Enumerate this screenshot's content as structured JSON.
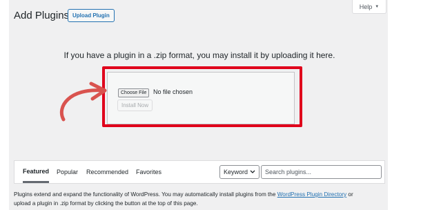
{
  "header": {
    "title": "Add Plugins",
    "upload_button": "Upload Plugin",
    "help_tab": "Help",
    "help_caret": "▼"
  },
  "upload": {
    "instructions": "If you have a plugin in a .zip format, you may install it by uploading it here.",
    "choose_file_button": "Choose File",
    "file_status": "No file chosen",
    "install_button": "Install Now"
  },
  "filters": {
    "tabs": [
      "Featured",
      "Popular",
      "Recommended",
      "Favorites"
    ],
    "active_tab": "Featured",
    "search_type": "Keyword",
    "search_placeholder": "Search plugins..."
  },
  "footer": {
    "text_before_link": "Plugins extend and expand the functionality of WordPress. You may automatically install plugins from the ",
    "link_text": "WordPress Plugin Directory",
    "text_after_link": " or",
    "second_line": "upload a plugin in .zip format by clicking the button at the top of this page."
  },
  "colors": {
    "highlight": "#e0001b",
    "arrow": "#d9534f",
    "link": "#2271b1",
    "background": "#f0f0f1"
  }
}
